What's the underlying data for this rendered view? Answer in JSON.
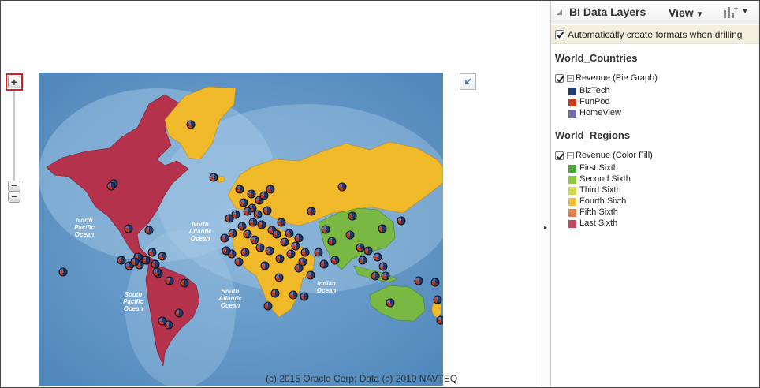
{
  "map": {
    "copyright": "(c) 2015 Oracle Corp; Data (c) 2010 NAVTEQ",
    "zoom_in_symbol": "+",
    "zoom_out_symbol": "−",
    "ocean_labels": [
      "North Pacific Ocean",
      "North Atlantic Ocean",
      "South Pacific Ocean",
      "South Atlantic Ocean",
      "Indian Ocean"
    ],
    "colors": {
      "ocean": "#5e95c4",
      "ocean_light": "#9fc4e0",
      "americas": "#b5324c",
      "gold": "#f0b929",
      "green": "#79b843"
    }
  },
  "panel": {
    "title": "BI Data Layers",
    "view_label": "View",
    "auto_format_label": "Automatically create formats when drilling",
    "auto_format_checked": true,
    "layers": [
      {
        "name": "World_Countries",
        "measure_label": "Revenue (Pie Graph)",
        "legend": [
          {
            "label": "BizTech",
            "color": "#1f3a6e"
          },
          {
            "label": "FunPod",
            "color": "#c43a1c"
          },
          {
            "label": "HomeView",
            "color": "#6e6ea6"
          }
        ]
      },
      {
        "name": "World_Regions",
        "measure_label": "Revenue (Color Fill)",
        "legend": [
          {
            "label": "First Sixth",
            "color": "#4aa53a"
          },
          {
            "label": "Second Sixth",
            "color": "#8cc63f"
          },
          {
            "label": "Third Sixth",
            "color": "#cfd84b"
          },
          {
            "label": "Fourth Sixth",
            "color": "#f2bd3a"
          },
          {
            "label": "Fifth Sixth",
            "color": "#e47c4e"
          },
          {
            "label": "Last Sixth",
            "color": "#c24761"
          }
        ]
      }
    ]
  }
}
